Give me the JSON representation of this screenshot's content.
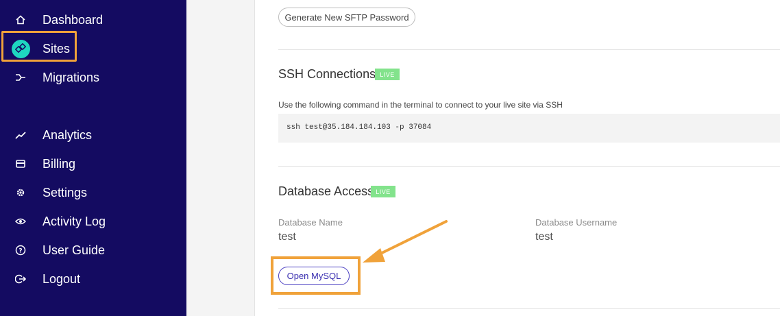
{
  "sidebar": {
    "items": [
      {
        "key": "dashboard",
        "label": "Dashboard",
        "icon": "home-icon"
      },
      {
        "key": "sites",
        "label": "Sites",
        "icon": "sites-icon"
      },
      {
        "key": "migrations",
        "label": "Migrations",
        "icon": "migrations-icon"
      },
      {
        "key": "analytics",
        "label": "Analytics",
        "icon": "analytics-icon"
      },
      {
        "key": "billing",
        "label": "Billing",
        "icon": "billing-icon"
      },
      {
        "key": "settings",
        "label": "Settings",
        "icon": "gear-icon"
      },
      {
        "key": "activity-log",
        "label": "Activity Log",
        "icon": "eye-icon"
      },
      {
        "key": "user-guide",
        "label": "User Guide",
        "icon": "help-icon"
      },
      {
        "key": "logout",
        "label": "Logout",
        "icon": "logout-icon"
      }
    ],
    "active": "sites",
    "colors": {
      "background": "#140b61",
      "sites_icon": "#1ed6c0",
      "highlight": "#f0a23a"
    }
  },
  "sftp": {
    "button_label": "Generate New SFTP Password"
  },
  "ssh": {
    "title": "SSH Connections",
    "badge": "LIVE",
    "description": "Use the following command in the terminal to connect to your live site via SSH",
    "command": "ssh test@35.184.184.103 -p 37084"
  },
  "database": {
    "title": "Database Access",
    "badge": "LIVE",
    "name_label": "Database Name",
    "name_value": "test",
    "username_label": "Database Username",
    "username_value": "test",
    "button_label": "Open MySQL"
  },
  "colors": {
    "badge": "#83e38c",
    "accent": "#3a2fb0",
    "annotation": "#f0a23a"
  }
}
